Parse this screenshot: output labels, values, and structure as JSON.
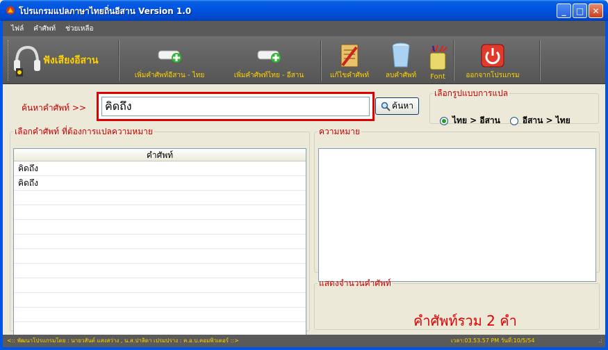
{
  "window": {
    "title": "โปรแกรมแปลภาษาไทยถิ่นอีสาน Version 1.0"
  },
  "menu": [
    "ไฟล์",
    "คำศัพท์",
    "ช่วยเหลือ"
  ],
  "toolbar": {
    "listen_label": "ฟังเสียงอีสาน",
    "add_isan_thai": "เพิ่มคำศัพท์อีสาน - ไทย",
    "add_thai_isan": "เพิ่มคำศัพท์ไทย - อีสาน",
    "edit_word": "แก้ไขคำศัพท์",
    "delete_word": "ลบคำศัพท์",
    "font": "Font",
    "exit": "ออกจากโปรแกรม"
  },
  "search": {
    "label": "ค้นหาคำศัพท์ >>",
    "value": "คิดถึง",
    "button": "ค้นหา"
  },
  "mode": {
    "legend": "เลือกรูปแบบการแปล",
    "thai_to_isan": "ไทย > อีสาน",
    "isan_to_thai": "อีสาน > ไทย",
    "selected": "thai_to_isan"
  },
  "word_list": {
    "legend": "เลือกคำศัพท์ ที่ต้องการแปลความหมาย",
    "header": "คำศัพท์",
    "rows": [
      "คิดถึง",
      "คิดถึง"
    ]
  },
  "meaning": {
    "legend": "ความหมาย"
  },
  "count": {
    "legend": "แสดงจำนวนคำศัพท์",
    "text": "คำศัพท์รวม  2  คำ"
  },
  "status": {
    "left": "<:: พัฒนาโปรแกรมโดย : นายวสันต์ แสงสว่าง , น.ส.ปาลิดา เปรมปราง : ค.อ.บ.คอมพิวเตอร์ ::>",
    "right": "เวลา:03.53.57 PM  วันที่:10/5/54"
  },
  "colors": {
    "accent_label": "#ffd200",
    "legend_red": "#c00000",
    "count_red": "#e00000"
  }
}
